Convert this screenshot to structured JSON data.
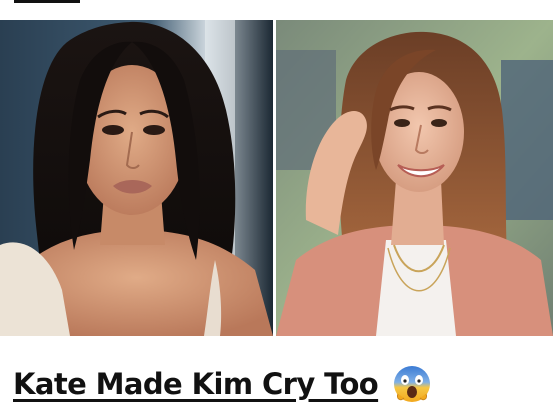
{
  "headline": {
    "title": "Kate Made Kim Cry Too",
    "emoji_icon": "face-screaming-in-fear-emoji"
  },
  "images": {
    "left": {
      "subject": "woman-with-long-dark-hair-portrait"
    },
    "right": {
      "subject": "woman-with-brown-hair-in-pink-blazer-portrait"
    }
  },
  "colors": {
    "text": "#111111",
    "background": "#ffffff",
    "blazer": "#d7907c"
  }
}
